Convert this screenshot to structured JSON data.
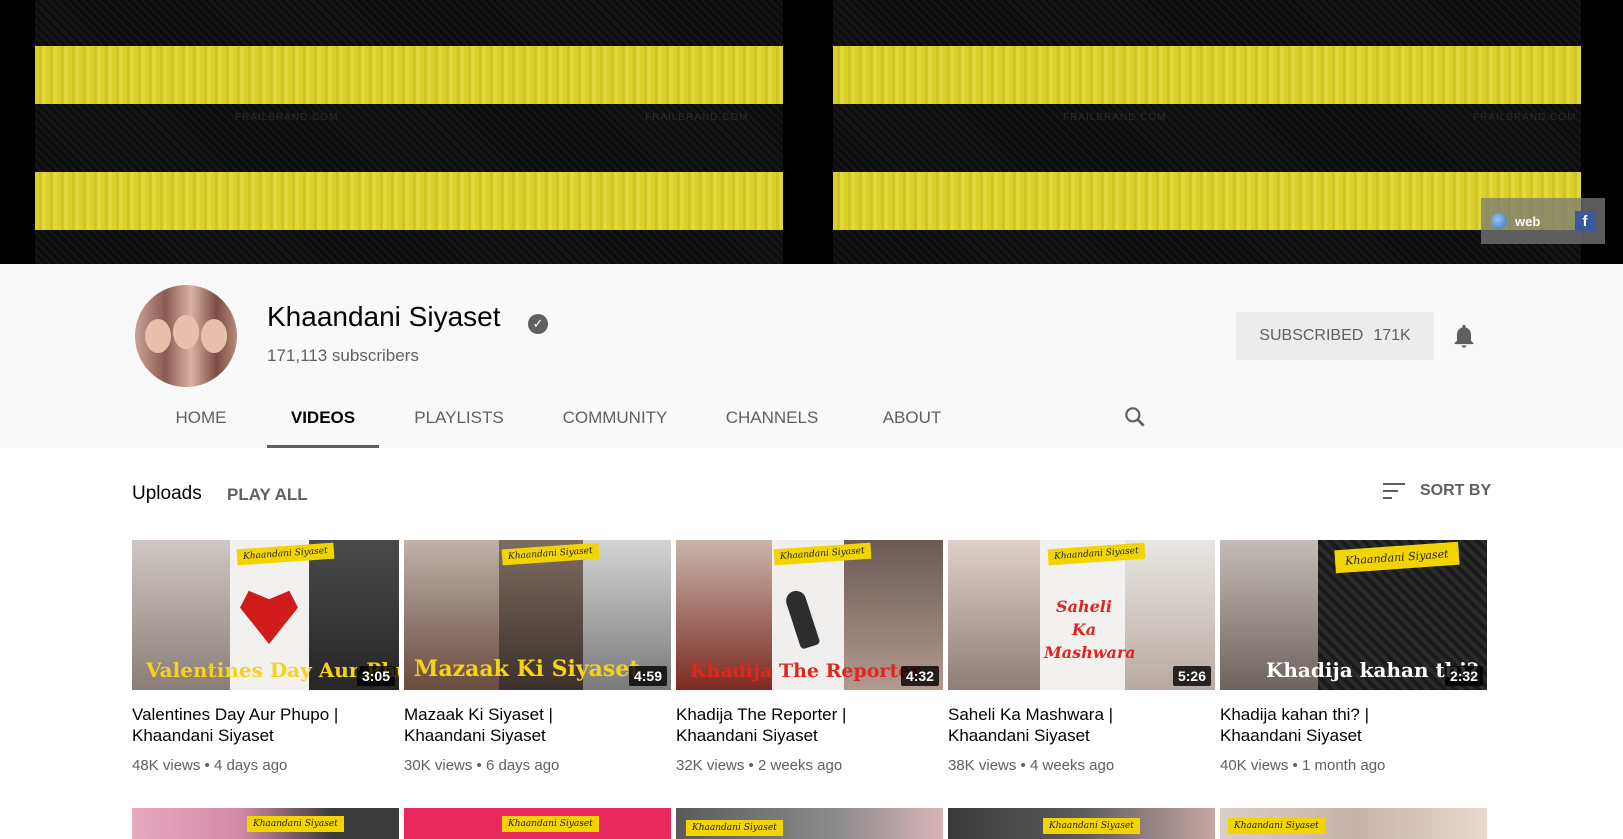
{
  "banner": {
    "watermark": "FRAILBRAND.COM",
    "links": {
      "web_label": "web",
      "facebook_icon": "facebook-icon",
      "globe_icon": "globe-icon"
    }
  },
  "channel": {
    "name": "Khaandani Siyaset",
    "subscribers": "171,113 subscribers",
    "subscribed_label": "SUBSCRIBED",
    "subscribed_count": "171K",
    "verified_icon": "check-circle-icon",
    "bell_icon": "bell-icon"
  },
  "tabs": [
    {
      "label": "HOME",
      "active": false
    },
    {
      "label": "VIDEOS",
      "active": true
    },
    {
      "label": "PLAYLISTS",
      "active": false
    },
    {
      "label": "COMMUNITY",
      "active": false
    },
    {
      "label": "CHANNELS",
      "active": false
    },
    {
      "label": "ABOUT",
      "active": false
    }
  ],
  "content": {
    "section_title": "Uploads",
    "play_all": "PLAY ALL",
    "sort_by": "SORT BY"
  },
  "videos": [
    {
      "title_line1": "Valentines Day Aur Phupo |",
      "title_line2": "Khaandani Siyaset",
      "views": "48K views",
      "age": "4 days ago",
      "duration": "3:05",
      "thumb_caption": "Valentines Day Aur Phupo",
      "tag": "Khaandani Siyaset"
    },
    {
      "title_line1": "Mazaak Ki Siyaset |",
      "title_line2": "Khaandani Siyaset",
      "views": "30K views",
      "age": "6 days ago",
      "duration": "4:59",
      "thumb_caption": "Mazaak Ki Siyaset",
      "tag": "Khaandani Siyaset"
    },
    {
      "title_line1": "Khadija The Reporter |",
      "title_line2": "Khaandani Siyaset",
      "views": "32K views",
      "age": "2 weeks ago",
      "duration": "4:32",
      "thumb_caption": "Khadija The Reporter",
      "tag": "Khaandani Siyaset"
    },
    {
      "title_line1": "Saheli Ka Mashwara |",
      "title_line2": "Khaandani Siyaset",
      "views": "38K views",
      "age": "4 weeks ago",
      "duration": "5:26",
      "thumb_caption": "Saheli Ka Mashwara",
      "tag": "Khaandani Siyaset"
    },
    {
      "title_line1": "Khadija kahan thi? |",
      "title_line2": "Khaandani Siyaset",
      "views": "40K views",
      "age": "1 month ago",
      "duration": "2:32",
      "thumb_caption": "Khadija kahan thi?",
      "tag": "Khaandani Siyaset"
    }
  ],
  "row2_tag": "Khaandani Siyaset",
  "meta_separator": "•"
}
